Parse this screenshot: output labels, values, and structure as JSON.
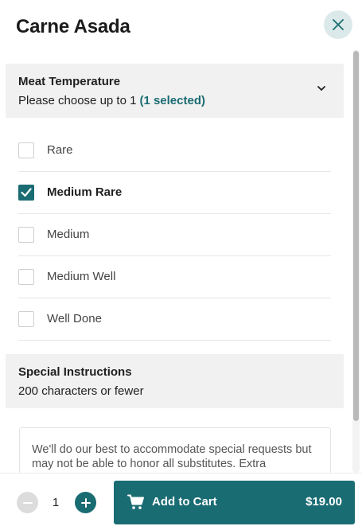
{
  "item": {
    "title": "Carne Asada",
    "close_icon": "close-icon"
  },
  "meat_section": {
    "title": "Meat Temperature",
    "subtitle": "Please choose up to 1",
    "selected_text": "(1 selected)",
    "chevron_icon": "chevron-down-icon",
    "options": [
      {
        "label": "Rare",
        "checked": false
      },
      {
        "label": "Medium Rare",
        "checked": true
      },
      {
        "label": "Medium",
        "checked": false
      },
      {
        "label": "Medium Well",
        "checked": false
      },
      {
        "label": "Well Done",
        "checked": false
      }
    ]
  },
  "instructions_section": {
    "title": "Special Instructions",
    "subtitle": "200 characters or fewer",
    "notice": "We'll do our best to accommodate special requests but may not be able to honor all substitutes. Extra"
  },
  "footer": {
    "quantity": "1",
    "add_to_cart_label": "Add to Cart",
    "price": "$19.00",
    "minus_icon": "minus-icon",
    "plus_icon": "plus-icon",
    "cart_icon": "cart-icon"
  },
  "colors": {
    "accent": "#1a6c73",
    "section_bg": "#f1f1f1",
    "close_bg": "#dce9ea"
  }
}
